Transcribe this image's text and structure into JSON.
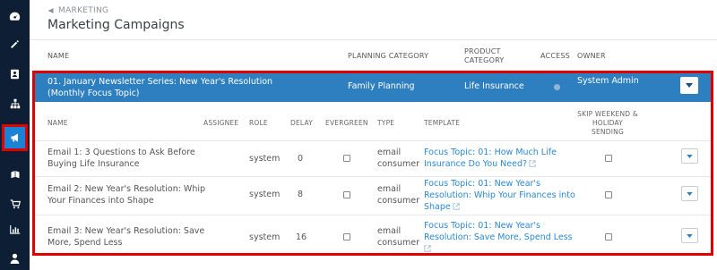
{
  "nav": {
    "items": [
      {
        "icon": "dashboard-icon"
      },
      {
        "icon": "pencil-icon"
      },
      {
        "icon": "contacts-icon"
      },
      {
        "icon": "hierarchy-icon"
      },
      {
        "icon": "megaphone-icon",
        "active": true
      },
      {
        "icon": "book-icon"
      },
      {
        "icon": "cart-icon"
      },
      {
        "icon": "reports-icon"
      },
      {
        "icon": "user-icon"
      }
    ]
  },
  "breadcrumb": {
    "label": "MARKETING"
  },
  "page_title": "Marketing Campaigns",
  "columns": {
    "name": "NAME",
    "planning_category": "PLANNING CATEGORY",
    "product_category_1": "PRODUCT",
    "product_category_2": "CATEGORY",
    "access": "ACCESS",
    "owner": "OWNER"
  },
  "campaign": {
    "name": "01. January Newsletter Series: New Year's Resolution (Monthly Focus Topic)",
    "planning_category": "Family Planning",
    "product_category": "Life Insurance",
    "owner": "System Admin"
  },
  "sub_columns": {
    "name": "NAME",
    "assignee": "ASSIGNEE",
    "role": "ROLE",
    "delay": "DELAY",
    "evergreen": "EVERGREEN",
    "type": "TYPE",
    "template": "TEMPLATE",
    "skip_1": "SKIP WEEKEND &",
    "skip_2": "HOLIDAY",
    "skip_3": "SENDING"
  },
  "emails": [
    {
      "name_1": "Email 1: 3 Questions to Ask Before",
      "name_2": "Buying Life Insurance",
      "role": "system",
      "delay": "0",
      "type_1": "email",
      "type_2": "consumer",
      "template_1": "Focus Topic: 01: How Much Life",
      "template_2": "Insurance Do You Need?"
    },
    {
      "name_1": "Email 2: New Year's Resolution: Whip",
      "name_2": "Your Finances into Shape",
      "role": "system",
      "delay": "8",
      "type_1": "email",
      "type_2": "consumer",
      "template_1": "Focus Topic: 01: New Year's",
      "template_2": "Resolution: Whip Your Finances into",
      "template_3": "Shape"
    },
    {
      "name_1": "Email 3: New Year's Resolution: Save",
      "name_2": "More, Spend Less",
      "role": "system",
      "delay": "16",
      "type_1": "email",
      "type_2": "consumer",
      "template_1": "Focus Topic: 01: New Year's",
      "template_2": "Resolution: Save More, Spend Less"
    }
  ],
  "colors": {
    "sidebar": "#0e1f35",
    "campaign_row": "#2e7fc0",
    "highlight": "#e00000",
    "link": "#2b88d0"
  }
}
